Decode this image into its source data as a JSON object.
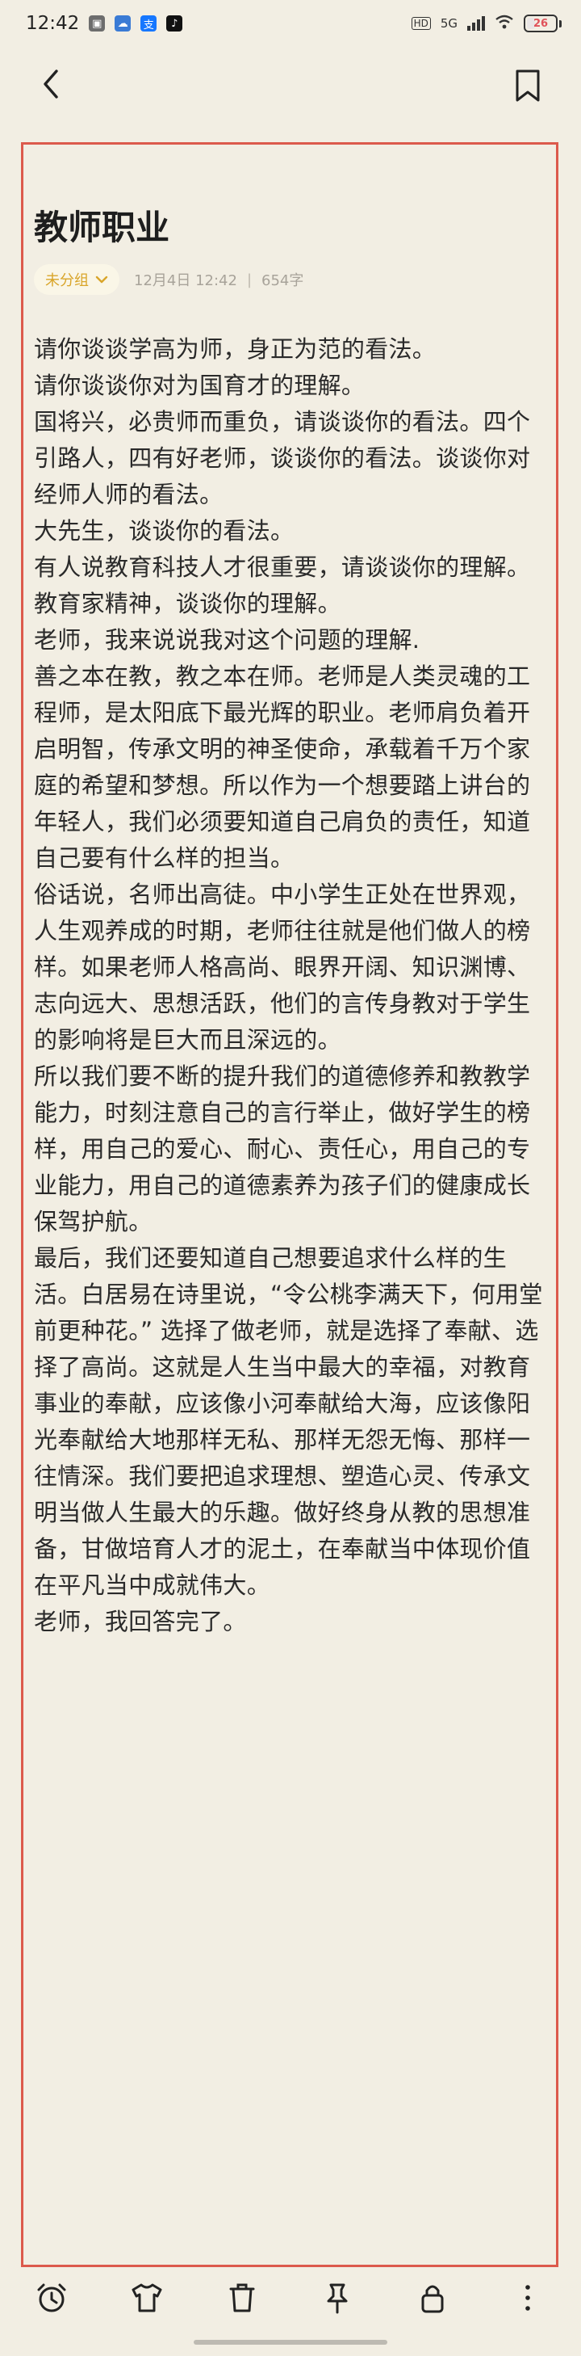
{
  "status_bar": {
    "time": "12:42",
    "network_badge": "HD",
    "signal_label": "5G",
    "battery_level": "26",
    "battery_fraction": 0.26,
    "app_icons": [
      "notification-icon",
      "weather-icon",
      "alipay-icon",
      "tiktok-icon"
    ]
  },
  "note": {
    "title": "教师职业",
    "category": "未分组",
    "date": "12月4日 12:42",
    "separator": "|",
    "word_count": "654字",
    "paragraphs": [
      "请你谈谈学高为师，身正为范的看法。",
      "请你谈谈你对为国育才的理解。",
      "国将兴，必贵师而重负，请谈谈你的看法。四个引路人，四有好老师，谈谈你的看法。谈谈你对经师人师的看法。",
      "大先生，谈谈你的看法。",
      "有人说教育科技人才很重要，请谈谈你的理解。",
      "教育家精神，谈谈你的理解。",
      "老师，我来说说我对这个问题的理解.",
      "善之本在教，教之本在师。老师是人类灵魂的工程师，是太阳底下最光辉的职业。老师肩负着开启明智，传承文明的神圣使命，承载着千万个家庭的希望和梦想。所以作为一个想要踏上讲台的年轻人，我们必须要知道自己肩负的责任，知道自己要有什么样的担当。",
      "俗话说，名师出高徒。中小学生正处在世界观，人生观养成的时期，老师往往就是他们做人的榜样。如果老师人格高尚、眼界开阔、知识渊博、志向远大、思想活跃，他们的言传身教对于学生的影响将是巨大而且深远的。",
      "所以我们要不断的提升我们的道德修养和教教学能力，时刻注意自己的言行举止，做好学生的榜样，用自己的爱心、耐心、责任心，用自己的专业能力，用自己的道德素养为孩子们的健康成长保驾护航。",
      "最后，我们还要知道自己想要追求什么样的生活。白居易在诗里说，“令公桃李满天下，何用堂前更种花。” 选择了做老师，就是选择了奉献、选择了高尚。这就是人生当中最大的幸福，对教育事业的奉献，应该像小河奉献给大海，应该像阳光奉献给大地那样无私、那样无怨无悔、那样一往情深。我们要把追求理想、塑造心灵、传承文明当做人生最大的乐趣。做好终身从教的思想准备，甘做培育人才的泥土，在奉献当中体现价值在平凡当中成就伟大。",
      "老师，我回答完了。"
    ]
  },
  "toolbar": {
    "icons": [
      "alarm-clock-icon",
      "tshirt-icon",
      "trash-icon",
      "pin-icon",
      "lock-icon",
      "more-icon"
    ]
  },
  "colors": {
    "background": "#f2eee3",
    "frame_border": "#dc5a4c",
    "category_text": "#d9a52a",
    "meta_text": "#a8a39a"
  }
}
